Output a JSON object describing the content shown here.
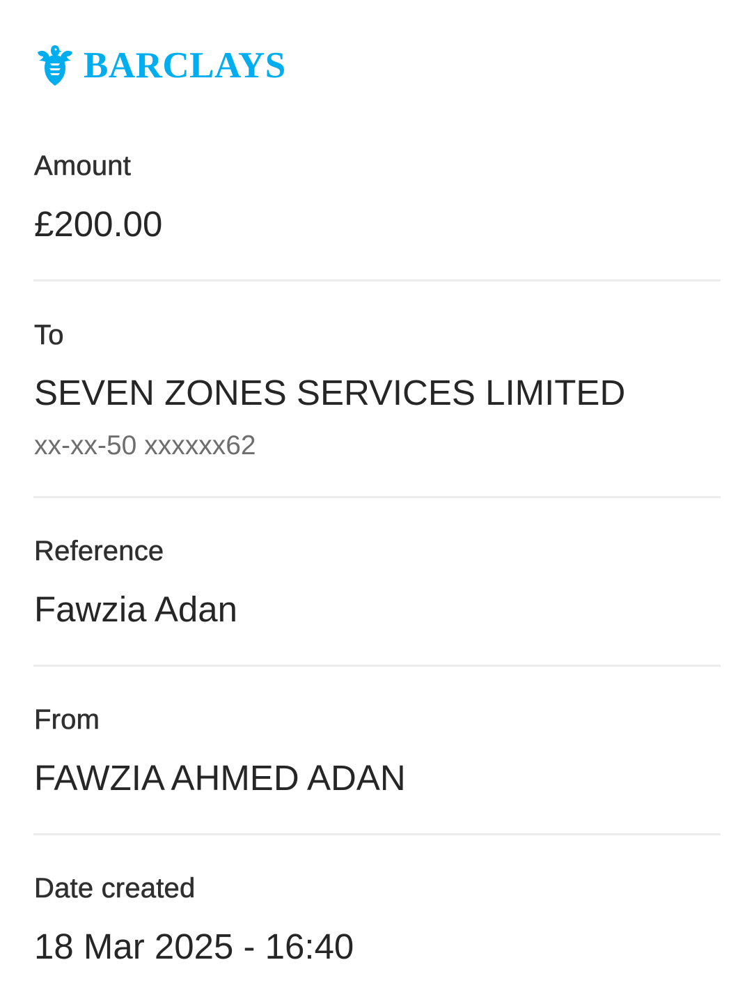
{
  "brand": {
    "name": "BARCLAYS",
    "color": "#00aeef",
    "icon": "eagle-icon"
  },
  "fields": {
    "amount": {
      "label": "Amount",
      "value": "£200.00"
    },
    "to": {
      "label": "To",
      "value": "SEVEN ZONES SERVICES LIMITED",
      "account": "xx-xx-50 xxxxxx62"
    },
    "reference": {
      "label": "Reference",
      "value": "Fawzia Adan"
    },
    "from": {
      "label": "From",
      "value": "FAWZIA AHMED ADAN"
    },
    "date_created": {
      "label": "Date created",
      "value": "18 Mar 2025 - 16:40"
    }
  }
}
